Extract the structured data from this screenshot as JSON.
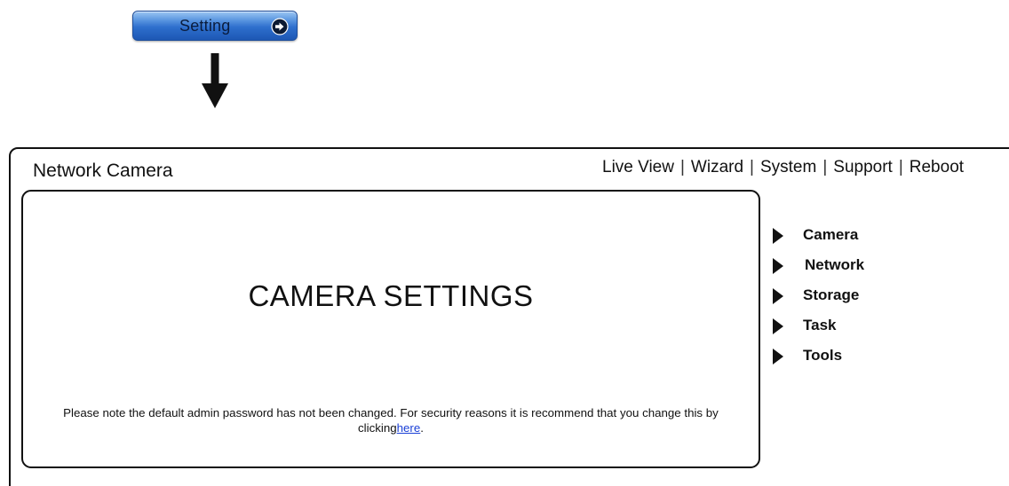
{
  "setting_button": {
    "label": "Setting",
    "icon": "arrow-right-circle-icon"
  },
  "flow_arrow": {
    "icon": "arrow-down-icon"
  },
  "header": {
    "title": "Network Camera",
    "nav": [
      {
        "label": "Live View"
      },
      {
        "label": "Wizard"
      },
      {
        "label": "System"
      },
      {
        "label": "Support"
      },
      {
        "label": "Reboot"
      }
    ]
  },
  "main": {
    "heading": "CAMERA SETTINGS",
    "notice_text": "Please note the default admin password has not been changed. For security reasons it is recommend that you change this by clicking",
    "notice_link": "here",
    "notice_end": "."
  },
  "sidebar": {
    "items": [
      {
        "label": "Camera",
        "icon": "triangle-right-icon"
      },
      {
        "label": "Network",
        "icon": "triangle-right-icon"
      },
      {
        "label": "Storage",
        "icon": "triangle-right-icon"
      },
      {
        "label": "Task",
        "icon": "triangle-right-icon"
      },
      {
        "label": "Tools",
        "icon": "triangle-right-icon"
      }
    ]
  },
  "colors": {
    "button_blue": "#2e6fcd",
    "link_blue": "#1a3fd6",
    "border": "#111111"
  }
}
